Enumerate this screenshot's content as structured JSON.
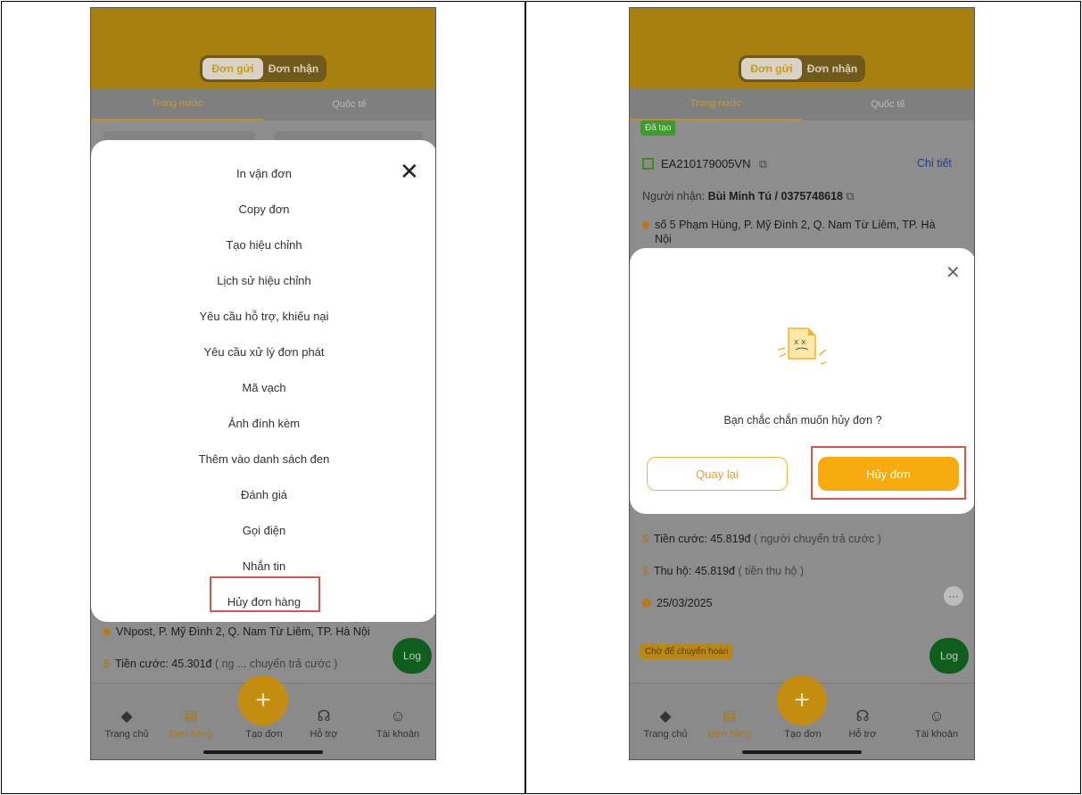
{
  "colors": {
    "brand": "#c48d10",
    "accent": "#f7ab0f",
    "highlight_border": "#d9534f",
    "log_button": "#0f5e1d"
  },
  "header": {
    "segment_sent": "Đơn gửi",
    "segment_received": "Đơn nhận"
  },
  "tabs": {
    "domestic": "Trong nước",
    "international": "Quốc tế"
  },
  "left": {
    "menu_items": [
      "In vận đơn",
      "Copy đơn",
      "Tạo hiệu chỉnh",
      "Lịch sử hiệu chỉnh",
      "Yêu cầu hỗ trợ, khiếu nại",
      "Yêu cầu xử lý đơn phát",
      "Mã vạch",
      "Ảnh đính kèm",
      "Thêm vào danh sách đen",
      "Đánh giá",
      "Gọi điện",
      "Nhắn tin",
      "Hủy đơn hàng"
    ],
    "close_icon": "close-icon",
    "address": "VNpost, P. Mỹ Đình 2, Q. Nam Từ Liêm, TP. Hà Nội",
    "fee_prefix": "Tiền cước: 45.301đ",
    "fee_suffix": "( ng  ...  chuyển trả cước )",
    "log_label": "Log"
  },
  "right": {
    "status_badge": "Đã tạo",
    "tracking_code": "EA210179005VN",
    "detail_link": "Chi tiết",
    "receiver_label": "Người nhận:",
    "receiver_value": "Bùi Minh Tú / 0375748618",
    "address_line1": "số 5 Phạm Hùng, P. Mỹ Đình 2, Q. Nam Từ Liêm, TP. Hà",
    "address_line2": "Nội",
    "dialog_message": "Bạn chắc chắn muốn hủy đơn ?",
    "back_button": "Quay lại",
    "cancel_button": "Hủy đơn",
    "fee": "Tiền cước: 45.819đ",
    "fee_note": "( người chuyển trả cước )",
    "cod": "Thu hộ: 45.819đ",
    "cod_note": "( tiền thu hộ )",
    "date": "25/03/2025",
    "return_badge": "Chờ để chuyển hoàn",
    "log_label": "Log"
  },
  "nav": {
    "home": "Trang chủ",
    "orders": "Đơn hàng",
    "create": "Tạo đơn",
    "support": "Hỗ trợ",
    "account": "Tài khoản",
    "fab_symbol": "+"
  }
}
